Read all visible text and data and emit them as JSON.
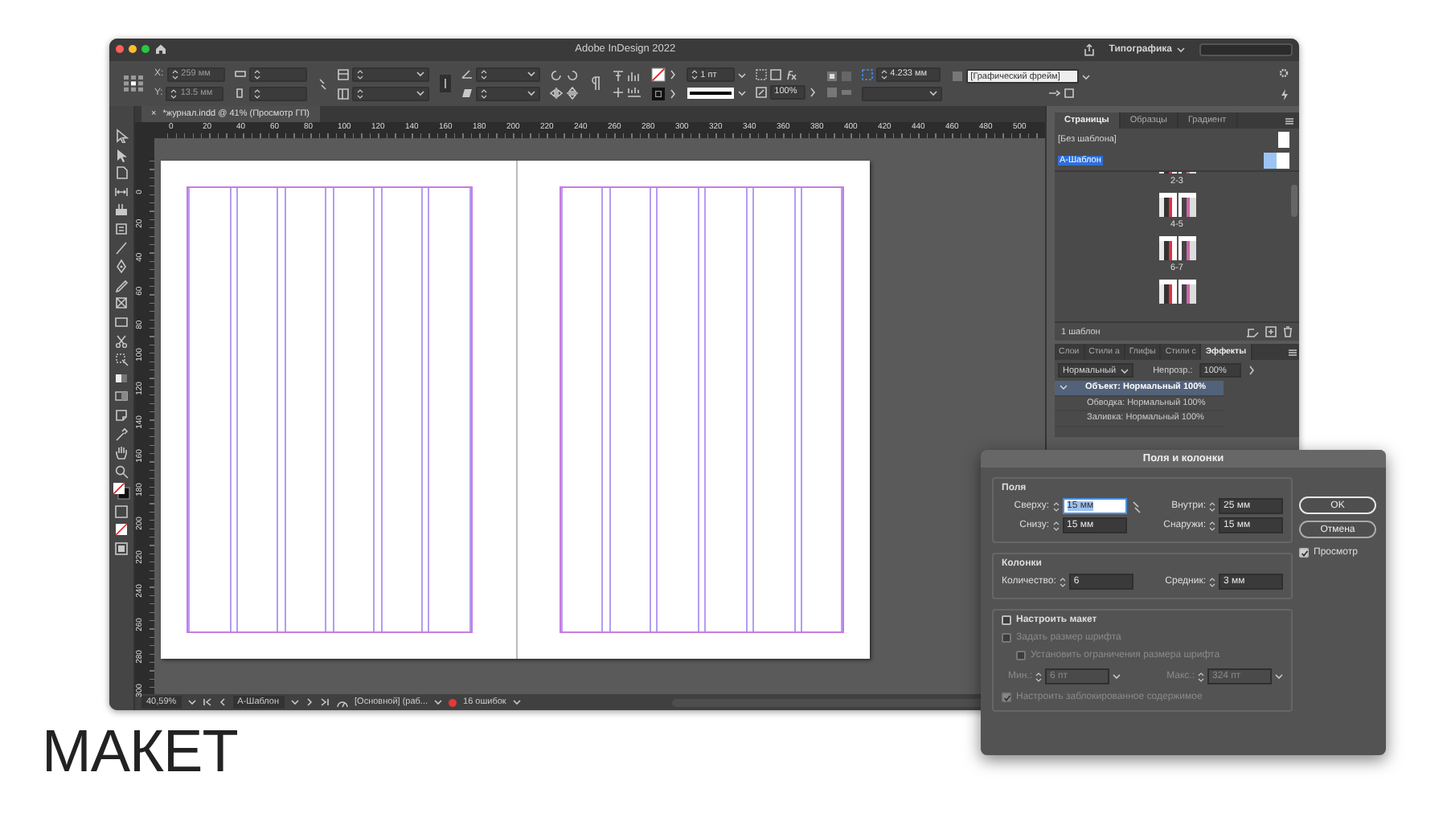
{
  "window": {
    "title": "Adobe InDesign 2022",
    "workspace": "Типографика"
  },
  "control_bar": {
    "x_label": "X:",
    "x": "259 мм",
    "y_label": "Y:",
    "y": "13.5 мм",
    "stroke_weight": "1 пт",
    "scale": "100%",
    "offset": "4.233 мм",
    "object_style": "[Графический фрейм]"
  },
  "document_tab": {
    "close": "×",
    "title": "*журнал.indd @ 41% (Просмотр ГП)"
  },
  "rulers": {
    "horizontal": [
      "0",
      "20",
      "40",
      "60",
      "80",
      "100",
      "120",
      "140",
      "160",
      "180",
      "200",
      "220",
      "240",
      "260",
      "280",
      "300",
      "320",
      "340",
      "360",
      "380",
      "400",
      "420",
      "440",
      "460",
      "480",
      "500"
    ],
    "vertical": [
      "0",
      "20",
      "40",
      "60",
      "80",
      "100",
      "120",
      "140",
      "160",
      "180",
      "200",
      "220",
      "240",
      "260",
      "280",
      "300"
    ]
  },
  "pages_panel": {
    "tabs": [
      {
        "label": "Страницы",
        "selected": true
      },
      {
        "label": "Образцы",
        "selected": false
      },
      {
        "label": "Градиент",
        "selected": false
      }
    ],
    "masters": [
      {
        "label": "[Без шаблона]",
        "selected": false
      },
      {
        "label": "А-Шаблон",
        "selected": true
      }
    ],
    "spreads": [
      {
        "label": "2-3"
      },
      {
        "label": "4-5"
      },
      {
        "label": "6-7"
      }
    ],
    "footer": "1 шаблон"
  },
  "effects_panel": {
    "tabs": [
      {
        "label": "Слои",
        "selected": false
      },
      {
        "label": "Стили а",
        "selected": false
      },
      {
        "label": "Глифы",
        "selected": false
      },
      {
        "label": "Стили с",
        "selected": false
      },
      {
        "label": "Эффекты",
        "selected": true
      }
    ],
    "blend_mode": "Нормальный",
    "opacity_label": "Непрозр.:",
    "opacity": "100%",
    "rows": [
      {
        "label": "Объект: Нормальный 100%",
        "kind": "object",
        "selected": true
      },
      {
        "label": "Обводка: Нормальный 100%",
        "kind": "attribute",
        "selected": false
      },
      {
        "label": "Заливка: Нормальный 100%",
        "kind": "attribute",
        "selected": false
      }
    ]
  },
  "status_bar": {
    "zoom": "40,59%",
    "page": "А-Шаблон",
    "preflight_profile": "[Основной] (раб...",
    "errors": "16 ошибок"
  },
  "dialog": {
    "title": "Поля и колонки",
    "margins": {
      "legend": "Поля",
      "fields": [
        {
          "label": "Сверху:",
          "value": "15 мм",
          "focused": true
        },
        {
          "label": "Внутри:",
          "value": "25 мм",
          "focused": false
        },
        {
          "label": "Снизу:",
          "value": "15 мм",
          "focused": false
        },
        {
          "label": "Снаружи:",
          "value": "15 мм",
          "focused": false
        }
      ]
    },
    "columns": {
      "legend": "Колонки",
      "number_label": "Количество:",
      "number": "6",
      "gutter_label": "Средник:",
      "gutter": "3 мм"
    },
    "adjust_layout": {
      "label": "Настроить макет",
      "checked": false
    },
    "font_size": {
      "label": "Задать размер шрифта",
      "checked": false,
      "disabled": true,
      "children": [
        {
          "label": "Установить ограничения размера шрифта",
          "checked": false,
          "disabled": true
        }
      ],
      "min_label": "Мин.:",
      "min": "6 пт",
      "max_label": "Макс.:",
      "max": "324 пт"
    },
    "locked_content": {
      "label": "Настроить заблокированное содержимое",
      "checked": true,
      "disabled": true
    },
    "buttons": [
      {
        "label": "OK",
        "default": true
      },
      {
        "label": "Отмена",
        "default": false
      }
    ],
    "preview": {
      "label": "Просмотр",
      "checked": true
    }
  },
  "caption": "МАКЕТ"
}
